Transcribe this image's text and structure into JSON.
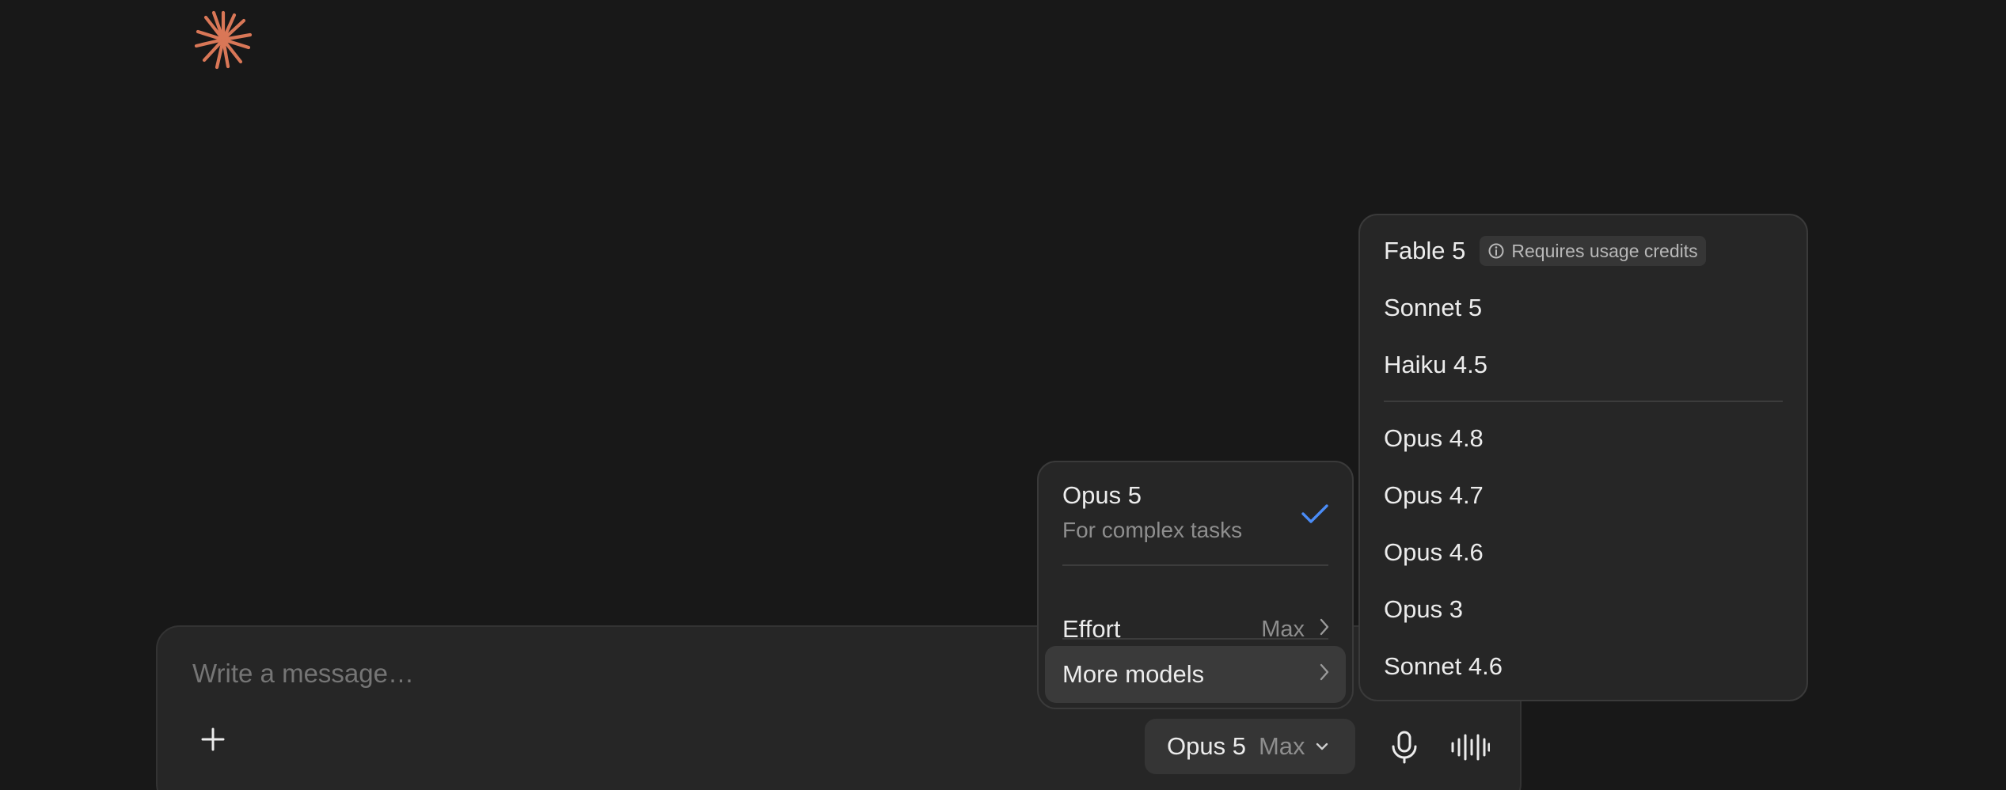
{
  "brand": {
    "logo_icon": "sparkle-logo-icon",
    "logo_color": "#d97757"
  },
  "composer": {
    "placeholder": "Write a message…",
    "model_name": "Opus 5",
    "model_effort": "Max"
  },
  "model_menu": {
    "selected": {
      "title": "Opus 5",
      "subtitle": "For complex tasks"
    },
    "effort": {
      "label": "Effort",
      "value": "Max"
    },
    "more_models": {
      "label": "More models"
    },
    "check_color": "#4a8cf7"
  },
  "more_models_menu": {
    "items": [
      {
        "label": "Fable 5",
        "badge": "Requires usage credits"
      },
      {
        "label": "Sonnet 5"
      },
      {
        "label": "Haiku 4.5"
      },
      {
        "label": "Opus 4.8"
      },
      {
        "label": "Opus 4.7"
      },
      {
        "label": "Opus 4.6"
      },
      {
        "label": "Opus 3"
      },
      {
        "label": "Sonnet 4.6"
      }
    ]
  }
}
